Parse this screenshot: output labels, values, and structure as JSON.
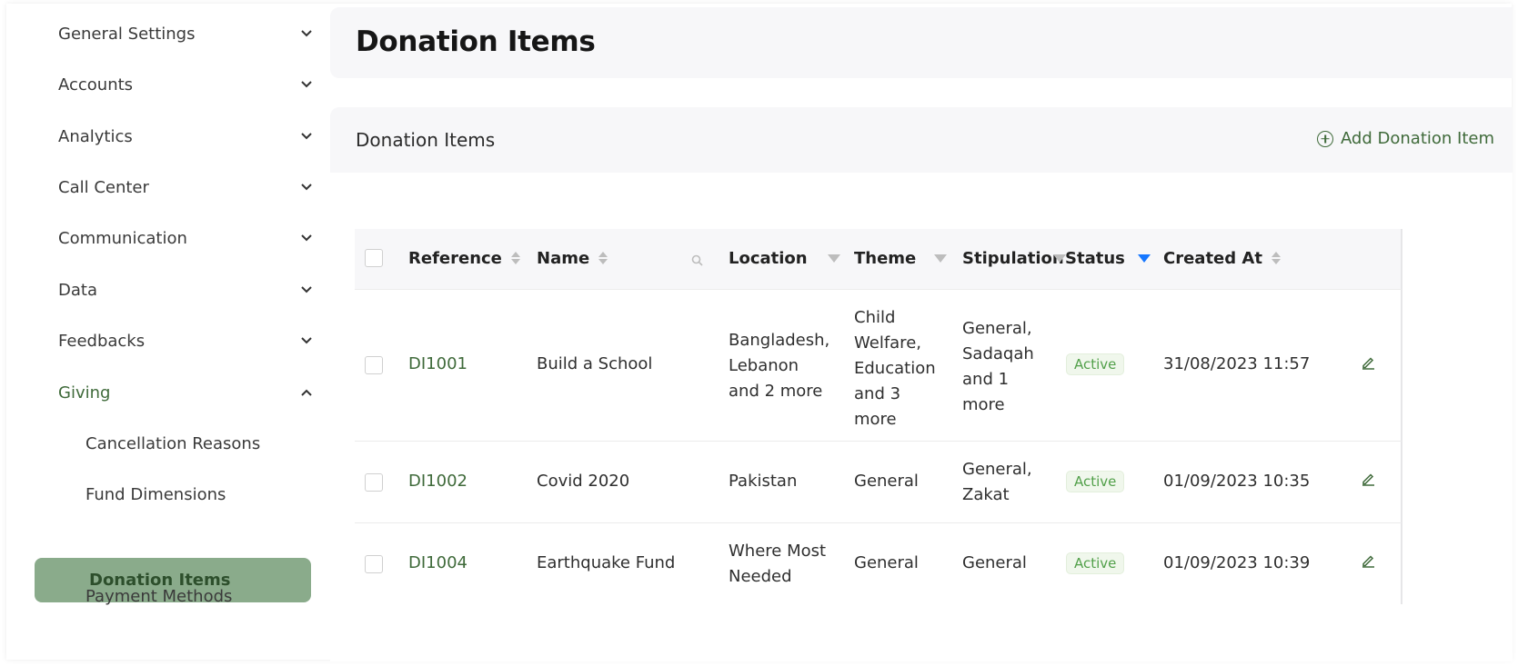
{
  "sidebar": {
    "items": [
      {
        "label": "General Settings"
      },
      {
        "label": "Accounts"
      },
      {
        "label": "Analytics"
      },
      {
        "label": "Call Center"
      },
      {
        "label": "Communication"
      },
      {
        "label": "Data"
      },
      {
        "label": "Feedbacks"
      },
      {
        "label": "Giving"
      }
    ],
    "giving_sub": [
      {
        "label": "Cancellation Reasons"
      },
      {
        "label": "Fund Dimensions"
      },
      {
        "label": "Donation Items"
      },
      {
        "label": "Payment Methods"
      }
    ]
  },
  "header": {
    "title": "Donation Items"
  },
  "card": {
    "title": "Donation Items",
    "add_label": "Add Donation Item"
  },
  "table": {
    "columns": {
      "reference": "Reference",
      "name": "Name",
      "location": "Location",
      "theme": "Theme",
      "stipulation": "Stipulation",
      "status": "Status",
      "created_at": "Created At"
    },
    "rows": [
      {
        "reference": "DI1001",
        "name": "Build a School",
        "location": [
          "Bangladesh,",
          "Lebanon",
          "and 2 more"
        ],
        "theme": [
          "Child",
          "Welfare,",
          "Education",
          "and 3",
          "more"
        ],
        "stipulation": [
          "General,",
          "Sadaqah",
          "and 1",
          "more"
        ],
        "status": "Active",
        "created_at": "31/08/2023 11:57"
      },
      {
        "reference": "DI1002",
        "name": "Covid 2020",
        "location": [
          "Pakistan"
        ],
        "theme": [
          "General"
        ],
        "stipulation": [
          "General,",
          "Zakat"
        ],
        "status": "Active",
        "created_at": "01/09/2023 10:35"
      },
      {
        "reference": "DI1004",
        "name": "Earthquake Fund",
        "location": [
          "Where Most",
          "Needed"
        ],
        "theme": [
          "General"
        ],
        "stipulation": [
          "General"
        ],
        "status": "Active",
        "created_at": "01/09/2023 10:39"
      }
    ]
  },
  "colors": {
    "accent": "#3f6a3a",
    "active_bg": "#8aab8b",
    "filter_active": "#1677ff",
    "status_active": "#52a04a"
  }
}
